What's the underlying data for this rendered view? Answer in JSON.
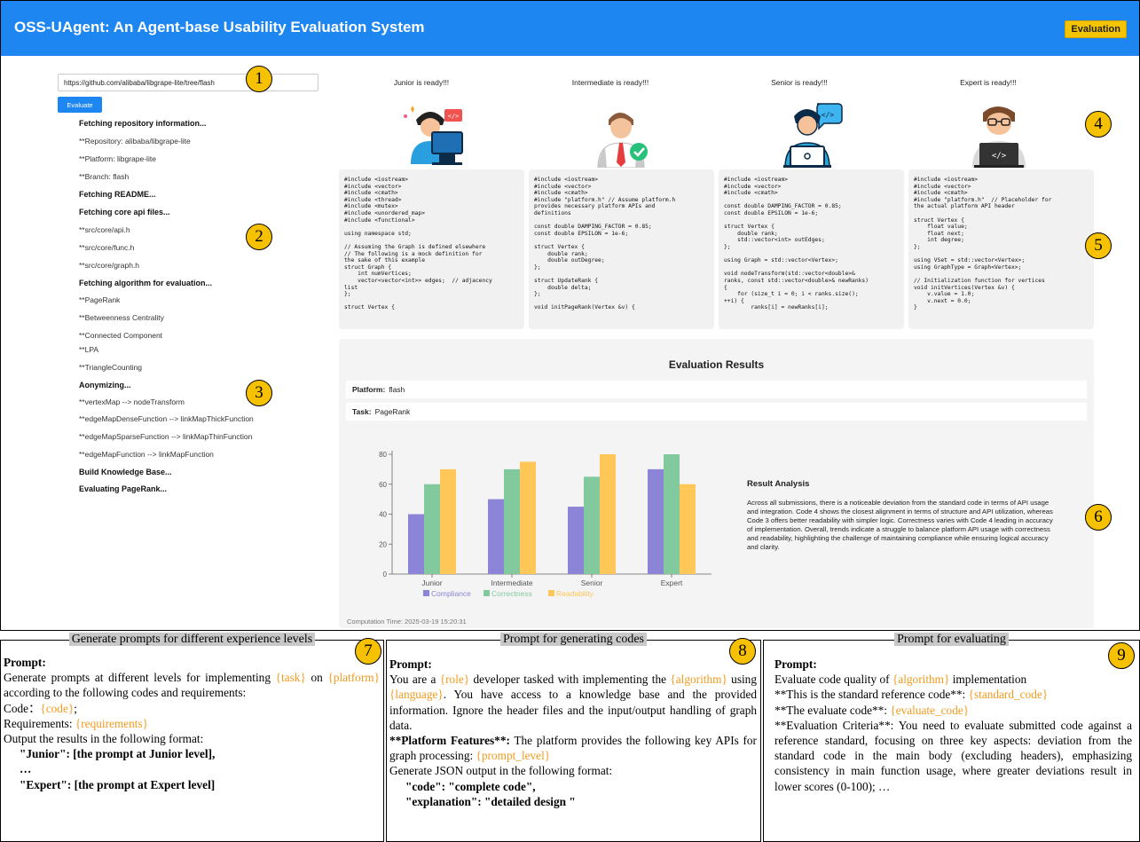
{
  "app": {
    "title": "OSS-UAgent: An Agent-base Usability Evaluation System",
    "header_button": "Evaluation",
    "colors": {
      "header": "#1d86f0",
      "badge": "#f6c100",
      "placeholder": "#f39a1e"
    }
  },
  "input": {
    "url_value": "https://github.com/alibaba/libgrape-lite/tree/flash",
    "evaluate_label": "Evaluate"
  },
  "log": [
    {
      "text": "Fetching repository information...",
      "bold": true
    },
    {
      "text": "**Repository: alibaba/libgrape-lite",
      "bold": false
    },
    {
      "text": "**Platform: libgrape-lite",
      "bold": false
    },
    {
      "text": "**Branch: flash",
      "bold": false
    },
    {
      "text": "Fetching README...",
      "bold": true
    },
    {
      "text": "Fetching core api files...",
      "bold": true
    },
    {
      "text": "**src/core/api.h",
      "bold": false
    },
    {
      "text": "**src/core/func.h",
      "bold": false
    },
    {
      "text": "**src/core/graph.h",
      "bold": false
    },
    {
      "text": "Fetching algorithm for evaluation...",
      "bold": true
    },
    {
      "text": "**PageRank",
      "bold": false
    },
    {
      "text": "**Betweenness Centrality",
      "bold": false
    },
    {
      "text": "**Connected Component",
      "bold": false
    },
    {
      "text": "**LPA",
      "bold": false
    },
    {
      "text": "**TriangleCounting",
      "bold": false
    },
    {
      "text": "Aonymizing...",
      "bold": true
    },
    {
      "text": "**vertexMap --> nodeTransform",
      "bold": false
    },
    {
      "text": "**edgeMapDenseFunction --> linkMapThickFunction",
      "bold": false
    },
    {
      "text": "**edgeMapSparseFunction --> linkMapThinFunction",
      "bold": false
    },
    {
      "text": "**edgeMapFunction --> linkMapFunction",
      "bold": false
    },
    {
      "text": "Build Knowledge Base...",
      "bold": true
    },
    {
      "text": "Evaluating PageRank...",
      "bold": true
    }
  ],
  "levels": [
    {
      "status": "Junior is ready!!!",
      "icon": "junior-developer-icon",
      "code": "#include <iostream>\n#include <vector>\n#include <cmath>\n#include <thread>\n#include <mutex>\n#include <unordered_map>\n#include <functional>\n\nusing namespace std;\n\n// Assuming the Graph is defined elsewhere\n// The following is a mock definition for\nthe sake of this example\nstruct Graph {\n    int numVertices;\n    vector<vector<int>> edges;  // adjacency\nlist\n};\n\nstruct Vertex {"
    },
    {
      "status": "Intermediate is ready!!!",
      "icon": "intermediate-developer-icon",
      "code": "#include <iostream>\n#include <vector>\n#include <cmath>\n#include \"platform.h\" // Assume platform.h\nprovides necessary platform APIs and\ndefinitions\n\nconst double DAMPING_FACTOR = 0.85;\nconst double EPSILON = 1e-6;\n\nstruct Vertex {\n    double rank;\n    double outDegree;\n};\n\nstruct UpdateRank {\n    double delta;\n};\n\nvoid initPageRank(Vertex &v) {"
    },
    {
      "status": "Senior is ready!!!",
      "icon": "senior-developer-icon",
      "code": "#include <iostream>\n#include <vector>\n#include <cmath>\n\nconst double DAMPING_FACTOR = 0.85;\nconst double EPSILON = 1e-6;\n\nstruct Vertex {\n    double rank;\n    std::vector<int> outEdges;\n};\n\nusing Graph = std::vector<Vertex>;\n\nvoid nodeTransform(std::vector<double>&\nranks, const std::vector<double>& newRanks)\n{\n    for (size_t i = 0; i < ranks.size();\n++i) {\n        ranks[i] = newRanks[i];"
    },
    {
      "status": "Expert is ready!!!",
      "icon": "expert-developer-icon",
      "code": "#include <iostream>\n#include <vector>\n#include <cmath>\n#include \"platform.h\"  // Placeholder for\nthe actual platform API header\n\nstruct Vertex {\n    float value;\n    float next;\n    int degree;\n};\n\nusing VSet = std::vector<Vertex>;\nusing GraphType = Graph<Vertex>;\n\n// Initialization function for vertices\nvoid initVertices(Vertex &v) {\n    v.value = 1.0;\n    v.next = 0.0;\n}"
    }
  ],
  "results": {
    "title": "Evaluation Results",
    "platform_label": "Platform:",
    "platform_value": "flash",
    "task_label": "Task:",
    "task_value": "PageRank",
    "analysis_title": "Result Analysis",
    "analysis_text": "Across all submissions, there is a noticeable deviation from the standard code in terms of API usage and integration. Code 4 shows the closest alignment in terms of structure and API utilization, whereas Code 3 offers better readability with simpler logic. Correctness varies with Code 4 leading in accuracy of implementation. Overall, trends indicate a struggle to balance platform API usage with correctness and readability, highlighting the challenge of maintaining compliance while ensuring logical accuracy and clarity.",
    "computation_time": "Computation Time: 2025-03-19 15:20:31"
  },
  "chart_data": {
    "type": "bar",
    "categories": [
      "Junior",
      "Intermediate",
      "Senior",
      "Expert"
    ],
    "series": [
      {
        "name": "Compliance",
        "values": [
          40,
          50,
          45,
          70
        ],
        "color": "#8b84d7"
      },
      {
        "name": "Correctness",
        "values": [
          60,
          70,
          65,
          80
        ],
        "color": "#82ca9d"
      },
      {
        "name": "Readability",
        "values": [
          70,
          75,
          80,
          60
        ],
        "color": "#ffc658"
      }
    ],
    "yticks": [
      0,
      20,
      40,
      60,
      80
    ],
    "ylim": [
      0,
      80
    ],
    "legend": "bottom"
  },
  "badges": [
    "1",
    "2",
    "3",
    "4",
    "5",
    "6",
    "7",
    "8",
    "9"
  ],
  "prompts": [
    {
      "title": "Generate prompts for different experience levels",
      "label": "Prompt:",
      "t1": "Generate prompts at different levels for implementing",
      "ph1": "{task}",
      "t2": " on ",
      "ph2": "{platform}",
      "t3": " according to the following codes and requirements:",
      "code_label": "Code：",
      "ph3": "{code}",
      "code_end": ";",
      "req_label": "Requirements: ",
      "ph4": "{requirements}",
      "t4": "Output the results in the following format:",
      "f1": "\"Junior\": [the prompt at Junior level],",
      "f2": "…",
      "f3": "\"Expert\": [the prompt at Expert level]"
    },
    {
      "title": "Prompt for generating codes",
      "label": "Prompt:",
      "t1": "You are a ",
      "ph1": "{role}",
      "t2": " developer tasked with implementing the ",
      "ph2": "{algorithm}",
      "t3": " using ",
      "ph3": "{language}",
      "t4": ". You have access to a knowledge base and the provided information. Ignore the header files and the input/output handling of graph data.",
      "feat_label": "**Platform Features**:",
      "t5": " The platform provides the following key APIs for graph processing: ",
      "ph4": "{prompt_level}",
      "t6": "Generate JSON output in the following format:",
      "f1": "\"code\": \"complete code\",",
      "f2": "\"explanation\": \"detailed design \""
    },
    {
      "title": "Prompt for evaluating",
      "label": "Prompt:",
      "t1": "Evaluate code quality of ",
      "ph1": "{algorithm}",
      "t2": " implementation",
      "t3": " **This is the standard reference code**: ",
      "ph2": "{standard_code}",
      "t4": "**The evaluate code**: ",
      "ph3": "{evaluate_code}",
      "t5": "**Evaluation Criteria**: You need to evaluate submitted code against a reference standard, focusing on three key aspects: deviation from the standard code in the main body (excluding headers), emphasizing consistency in main function usage, where greater deviations result in lower scores (0-100); …"
    }
  ]
}
